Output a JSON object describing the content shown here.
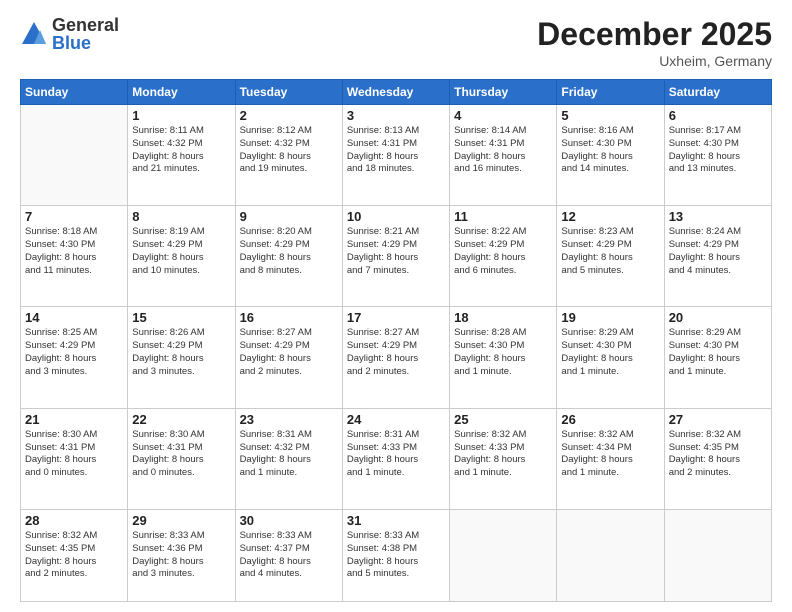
{
  "logo": {
    "general": "General",
    "blue": "Blue"
  },
  "header": {
    "month": "December 2025",
    "location": "Uxheim, Germany"
  },
  "weekdays": [
    "Sunday",
    "Monday",
    "Tuesday",
    "Wednesday",
    "Thursday",
    "Friday",
    "Saturday"
  ],
  "weeks": [
    [
      {
        "day": "",
        "info": ""
      },
      {
        "day": "1",
        "info": "Sunrise: 8:11 AM\nSunset: 4:32 PM\nDaylight: 8 hours\nand 21 minutes."
      },
      {
        "day": "2",
        "info": "Sunrise: 8:12 AM\nSunset: 4:32 PM\nDaylight: 8 hours\nand 19 minutes."
      },
      {
        "day": "3",
        "info": "Sunrise: 8:13 AM\nSunset: 4:31 PM\nDaylight: 8 hours\nand 18 minutes."
      },
      {
        "day": "4",
        "info": "Sunrise: 8:14 AM\nSunset: 4:31 PM\nDaylight: 8 hours\nand 16 minutes."
      },
      {
        "day": "5",
        "info": "Sunrise: 8:16 AM\nSunset: 4:30 PM\nDaylight: 8 hours\nand 14 minutes."
      },
      {
        "day": "6",
        "info": "Sunrise: 8:17 AM\nSunset: 4:30 PM\nDaylight: 8 hours\nand 13 minutes."
      }
    ],
    [
      {
        "day": "7",
        "info": "Sunrise: 8:18 AM\nSunset: 4:30 PM\nDaylight: 8 hours\nand 11 minutes."
      },
      {
        "day": "8",
        "info": "Sunrise: 8:19 AM\nSunset: 4:29 PM\nDaylight: 8 hours\nand 10 minutes."
      },
      {
        "day": "9",
        "info": "Sunrise: 8:20 AM\nSunset: 4:29 PM\nDaylight: 8 hours\nand 8 minutes."
      },
      {
        "day": "10",
        "info": "Sunrise: 8:21 AM\nSunset: 4:29 PM\nDaylight: 8 hours\nand 7 minutes."
      },
      {
        "day": "11",
        "info": "Sunrise: 8:22 AM\nSunset: 4:29 PM\nDaylight: 8 hours\nand 6 minutes."
      },
      {
        "day": "12",
        "info": "Sunrise: 8:23 AM\nSunset: 4:29 PM\nDaylight: 8 hours\nand 5 minutes."
      },
      {
        "day": "13",
        "info": "Sunrise: 8:24 AM\nSunset: 4:29 PM\nDaylight: 8 hours\nand 4 minutes."
      }
    ],
    [
      {
        "day": "14",
        "info": "Sunrise: 8:25 AM\nSunset: 4:29 PM\nDaylight: 8 hours\nand 3 minutes."
      },
      {
        "day": "15",
        "info": "Sunrise: 8:26 AM\nSunset: 4:29 PM\nDaylight: 8 hours\nand 3 minutes."
      },
      {
        "day": "16",
        "info": "Sunrise: 8:27 AM\nSunset: 4:29 PM\nDaylight: 8 hours\nand 2 minutes."
      },
      {
        "day": "17",
        "info": "Sunrise: 8:27 AM\nSunset: 4:29 PM\nDaylight: 8 hours\nand 2 minutes."
      },
      {
        "day": "18",
        "info": "Sunrise: 8:28 AM\nSunset: 4:30 PM\nDaylight: 8 hours\nand 1 minute."
      },
      {
        "day": "19",
        "info": "Sunrise: 8:29 AM\nSunset: 4:30 PM\nDaylight: 8 hours\nand 1 minute."
      },
      {
        "day": "20",
        "info": "Sunrise: 8:29 AM\nSunset: 4:30 PM\nDaylight: 8 hours\nand 1 minute."
      }
    ],
    [
      {
        "day": "21",
        "info": "Sunrise: 8:30 AM\nSunset: 4:31 PM\nDaylight: 8 hours\nand 0 minutes."
      },
      {
        "day": "22",
        "info": "Sunrise: 8:30 AM\nSunset: 4:31 PM\nDaylight: 8 hours\nand 0 minutes."
      },
      {
        "day": "23",
        "info": "Sunrise: 8:31 AM\nSunset: 4:32 PM\nDaylight: 8 hours\nand 1 minute."
      },
      {
        "day": "24",
        "info": "Sunrise: 8:31 AM\nSunset: 4:33 PM\nDaylight: 8 hours\nand 1 minute."
      },
      {
        "day": "25",
        "info": "Sunrise: 8:32 AM\nSunset: 4:33 PM\nDaylight: 8 hours\nand 1 minute."
      },
      {
        "day": "26",
        "info": "Sunrise: 8:32 AM\nSunset: 4:34 PM\nDaylight: 8 hours\nand 1 minute."
      },
      {
        "day": "27",
        "info": "Sunrise: 8:32 AM\nSunset: 4:35 PM\nDaylight: 8 hours\nand 2 minutes."
      }
    ],
    [
      {
        "day": "28",
        "info": "Sunrise: 8:32 AM\nSunset: 4:35 PM\nDaylight: 8 hours\nand 2 minutes."
      },
      {
        "day": "29",
        "info": "Sunrise: 8:33 AM\nSunset: 4:36 PM\nDaylight: 8 hours\nand 3 minutes."
      },
      {
        "day": "30",
        "info": "Sunrise: 8:33 AM\nSunset: 4:37 PM\nDaylight: 8 hours\nand 4 minutes."
      },
      {
        "day": "31",
        "info": "Sunrise: 8:33 AM\nSunset: 4:38 PM\nDaylight: 8 hours\nand 5 minutes."
      },
      {
        "day": "",
        "info": ""
      },
      {
        "day": "",
        "info": ""
      },
      {
        "day": "",
        "info": ""
      }
    ]
  ]
}
